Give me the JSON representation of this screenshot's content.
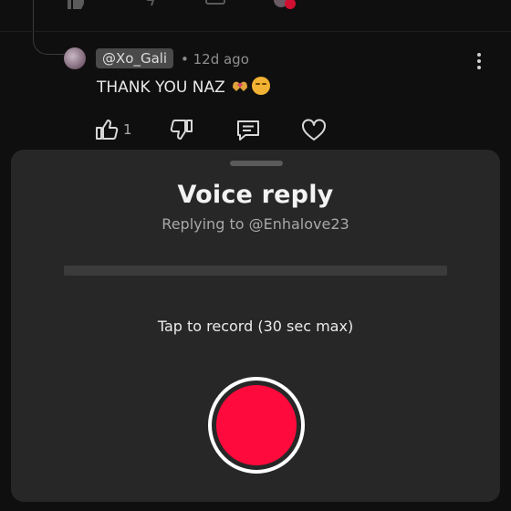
{
  "comment": {
    "handle": "@Xo_Gali",
    "time": "• 12d ago",
    "text": "THANK YOU NAZ",
    "emoji_icons": [
      "heart-hands-icon",
      "smiling-face-icon"
    ],
    "like_count": "1"
  },
  "sheet": {
    "title": "Voice reply",
    "subtitle": "Replying to @Enhalove23",
    "record_progress": 0,
    "hint": "Tap to record (30 sec max)"
  },
  "colors": {
    "accent": "#ff0a3c",
    "sheet_bg": "#272727",
    "page_bg": "#0f0f0f",
    "muted_text": "#a8a8a8"
  }
}
